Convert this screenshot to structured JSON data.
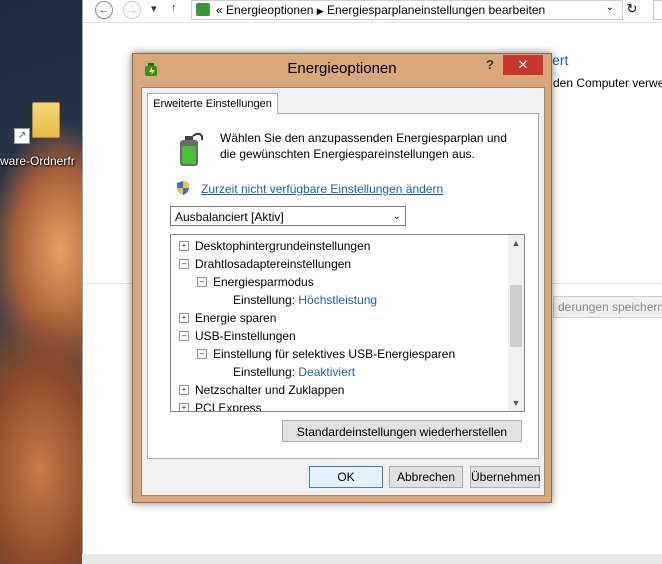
{
  "desktop": {
    "icon_label": "ware-Ordnerfr"
  },
  "explorer": {
    "nav_small": "«",
    "breadcrumbs": [
      "Energieoptionen",
      "Energiesparplaneinstellungen bearbeiten"
    ],
    "bg_link": "iert",
    "bg_text": "den Computer verwe",
    "bg_save": "derungen speichern"
  },
  "dialog": {
    "title": "Energieoptionen",
    "help": "?",
    "close": "✕",
    "tab": "Erweiterte Einstellungen",
    "intro": "Wählen Sie den anzupassenden Energiesparplan und die gewünschten Energiespareinstellungen aus.",
    "change_link": "Zurzeit nicht verfügbare Einstellungen ändern",
    "plan_selected": "Ausbalanciert [Aktiv]",
    "tree": [
      {
        "label": "Desktophintergrundeinstellungen",
        "toggle": "+",
        "level": 0
      },
      {
        "label": "Drahtlosadaptereinstellungen",
        "toggle": "−",
        "level": 0
      },
      {
        "label": "Energiesparmodus",
        "toggle": "−",
        "level": 1
      },
      {
        "label": "Einstellung:",
        "value": "Höchstleistung",
        "level": 2
      },
      {
        "label": "Energie sparen",
        "toggle": "+",
        "level": 0
      },
      {
        "label": "USB-Einstellungen",
        "toggle": "−",
        "level": 0
      },
      {
        "label": "Einstellung für selektives USB-Energiesparen",
        "toggle": "−",
        "level": 1
      },
      {
        "label": "Einstellung:",
        "value": "Deaktiviert",
        "level": 2
      },
      {
        "label": "Netzschalter und Zuklappen",
        "toggle": "+",
        "level": 0
      },
      {
        "label": "PCI Express",
        "toggle": "+",
        "level": 0
      }
    ],
    "restore_button": "Standardeinstellungen wiederherstellen",
    "ok": "OK",
    "cancel": "Abbrechen",
    "apply": "Übernehmen"
  }
}
